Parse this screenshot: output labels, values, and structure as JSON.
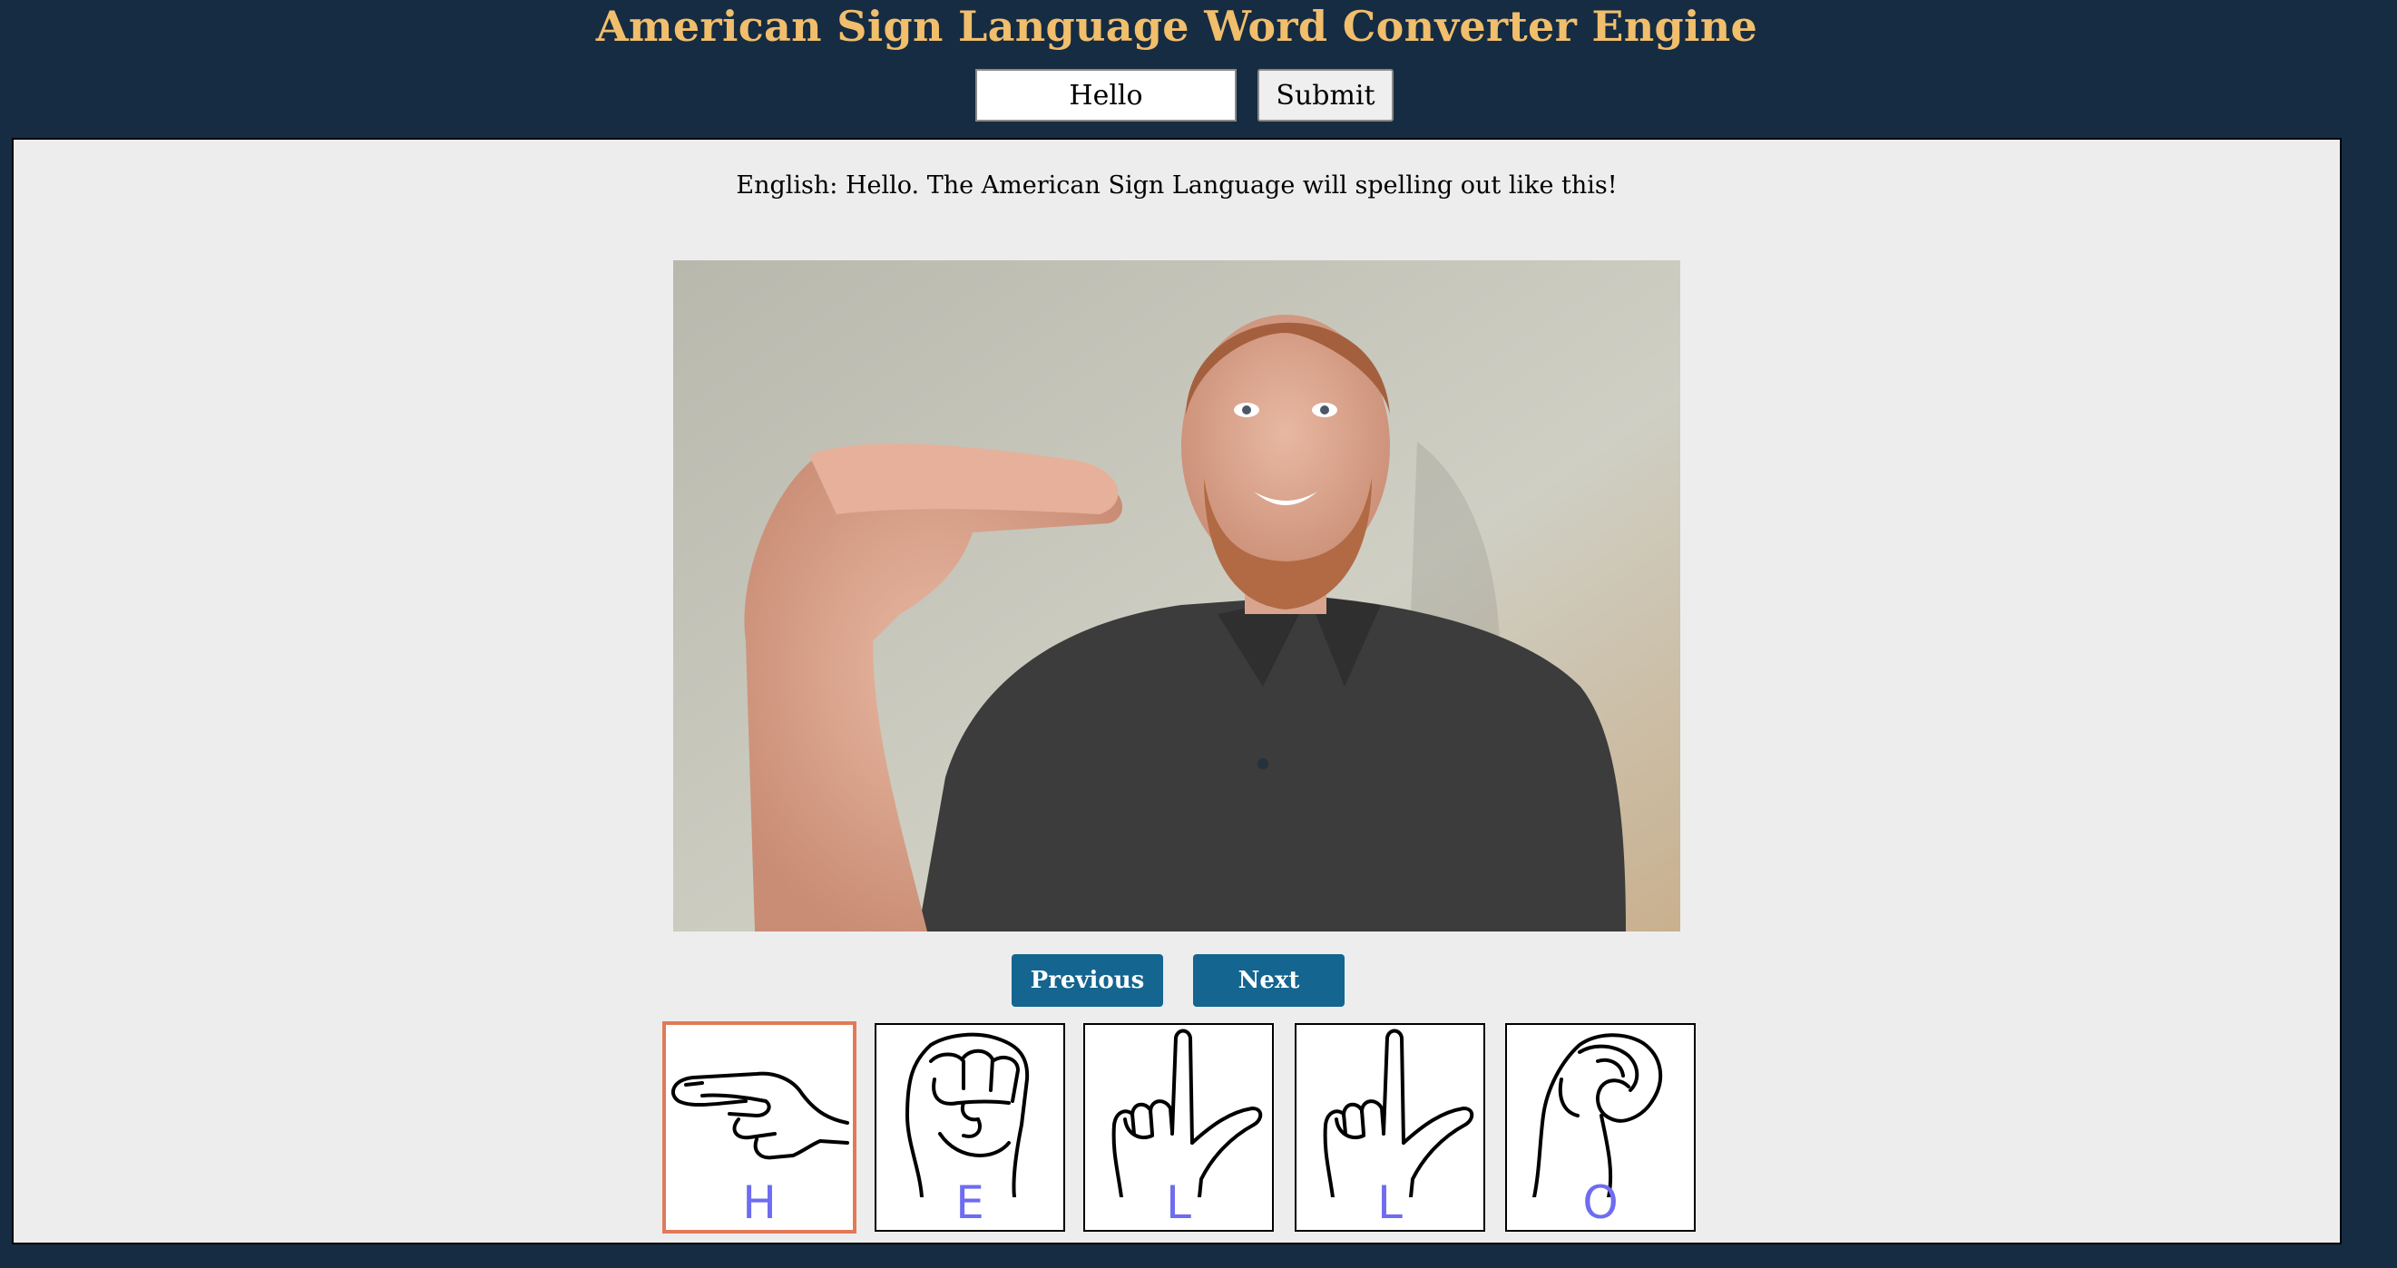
{
  "header": {
    "title": "American Sign Language Word Converter Engine"
  },
  "form": {
    "input_value": "Hello",
    "submit_label": "Submit"
  },
  "result": {
    "caption": "English: Hello. The American Sign Language will spelling out like this!",
    "previous_label": "Previous",
    "next_label": "Next",
    "active_index": 0,
    "letters": [
      "H",
      "E",
      "L",
      "L",
      "O"
    ]
  },
  "colors": {
    "background": "#162c42",
    "title": "#f1be6c",
    "panel": "#ededed",
    "nav_button": "#14658f",
    "active_card_border": "#e07a58",
    "letter": "#6e6cf0"
  },
  "icons": {
    "cards": [
      "hand-sign-h-icon",
      "hand-sign-e-icon",
      "hand-sign-l-icon",
      "hand-sign-l-icon",
      "hand-sign-o-icon"
    ]
  }
}
